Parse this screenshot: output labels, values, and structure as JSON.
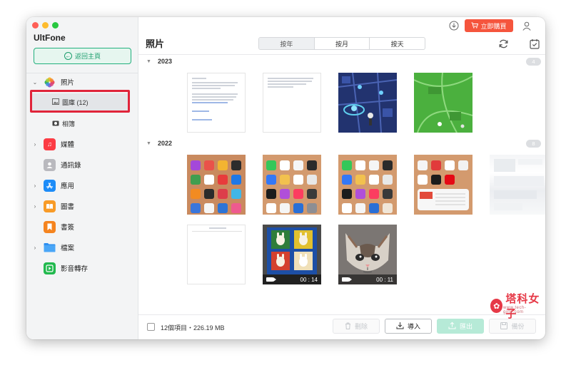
{
  "app": {
    "brand": "UltFone"
  },
  "sidebar": {
    "home_button": "返回主頁",
    "items": [
      {
        "label": "照片",
        "icon": "photos-icon",
        "color": "#ffffff"
      },
      {
        "label": "媒體",
        "icon": "music-icon",
        "color": "#fc3c44"
      },
      {
        "label": "通訊錄",
        "icon": "contacts-icon",
        "color": "#a8a8ad"
      },
      {
        "label": "應用",
        "icon": "app-store-icon",
        "color": "#1d8cf8"
      },
      {
        "label": "圖書",
        "icon": "books-icon",
        "color": "#f89b27"
      },
      {
        "label": "書簽",
        "icon": "bookmark-icon",
        "color": "#f5841f"
      },
      {
        "label": "檔案",
        "icon": "folder-icon",
        "color": "#2d8ff0"
      },
      {
        "label": "影音轉存",
        "icon": "video-convert-icon",
        "color": "#22b94e"
      }
    ],
    "sub_items": [
      {
        "label": "圖庫 (12)"
      },
      {
        "label": "相簿"
      }
    ]
  },
  "header": {
    "title": "照片",
    "tabs": [
      "按年",
      "按月",
      "按天"
    ],
    "active_tab": "按年",
    "buy_button": "立即購買"
  },
  "years": [
    {
      "year": "2023",
      "count": "4"
    },
    {
      "year": "2022",
      "count": "8"
    }
  ],
  "videos": [
    {
      "duration": "00 : 14"
    },
    {
      "duration": "00 : 11"
    }
  ],
  "footer": {
    "summary": "12個項目・226.19 MB",
    "delete": "刪除",
    "import": "導入",
    "export": "匯出",
    "backup": "備份"
  },
  "watermark": {
    "title": "塔科女子",
    "subtitle": "www.tech-girlz.com"
  },
  "colors": {
    "accent": "#22b07d",
    "buy": "#f5553d",
    "highlight": "#e0243a"
  }
}
